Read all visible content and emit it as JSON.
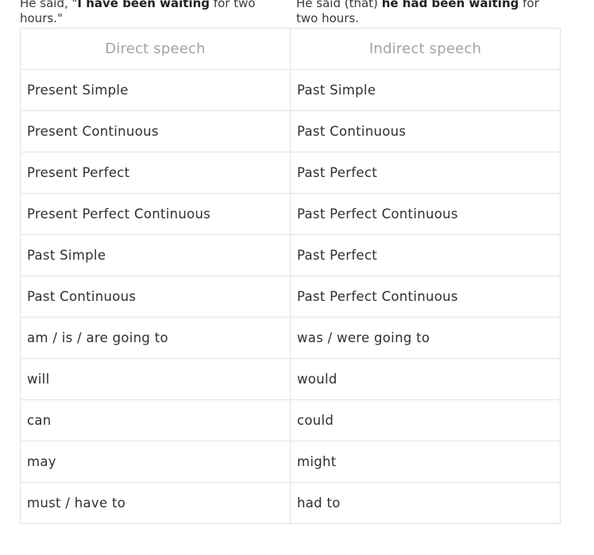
{
  "example": {
    "direct": {
      "prefix": "He said, \"",
      "bold": "I have been waiting",
      "suffix": " for two hours.\""
    },
    "indirect": {
      "prefix": "He said (that) ",
      "bold": "he had been waiting",
      "suffix": " for two hours."
    }
  },
  "table": {
    "headers": [
      "Direct speech",
      "Indirect speech"
    ],
    "rows": [
      [
        "Present Simple",
        "Past Simple"
      ],
      [
        "Present Continuous",
        "Past Continuous"
      ],
      [
        "Present Perfect",
        "Past Perfect"
      ],
      [
        "Present Perfect Continuous",
        "Past Perfect Continuous"
      ],
      [
        "Past Simple",
        "Past Perfect"
      ],
      [
        "Past Continuous",
        "Past Perfect Continuous"
      ],
      [
        "am / is / are going to",
        "was / were going to"
      ],
      [
        "will",
        "would"
      ],
      [
        "can",
        "could"
      ],
      [
        "may",
        "might"
      ],
      [
        "must / have to",
        "had to"
      ]
    ]
  }
}
